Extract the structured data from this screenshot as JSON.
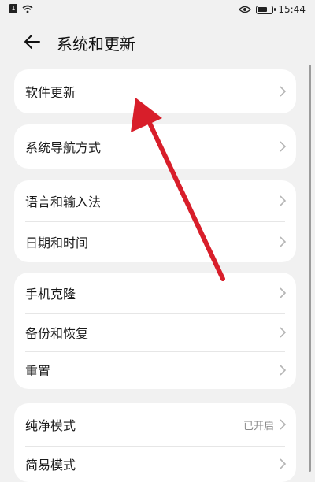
{
  "status_bar": {
    "sim_label": "1",
    "time": "15:44"
  },
  "header": {
    "title": "系统和更新"
  },
  "groups": [
    {
      "items": [
        {
          "label": "软件更新"
        }
      ]
    },
    {
      "items": [
        {
          "label": "系统导航方式"
        }
      ]
    },
    {
      "items": [
        {
          "label": "语言和输入法"
        },
        {
          "label": "日期和时间"
        }
      ]
    },
    {
      "items": [
        {
          "label": "手机克隆"
        },
        {
          "label": "备份和恢复"
        },
        {
          "label": "重置"
        }
      ]
    },
    {
      "items": [
        {
          "label": "纯净模式",
          "value": "已开启"
        },
        {
          "label": "简易模式"
        }
      ]
    }
  ],
  "colors": {
    "annotation_arrow": "#d81e2a",
    "background": "#f1f1f1",
    "card": "#ffffff"
  }
}
